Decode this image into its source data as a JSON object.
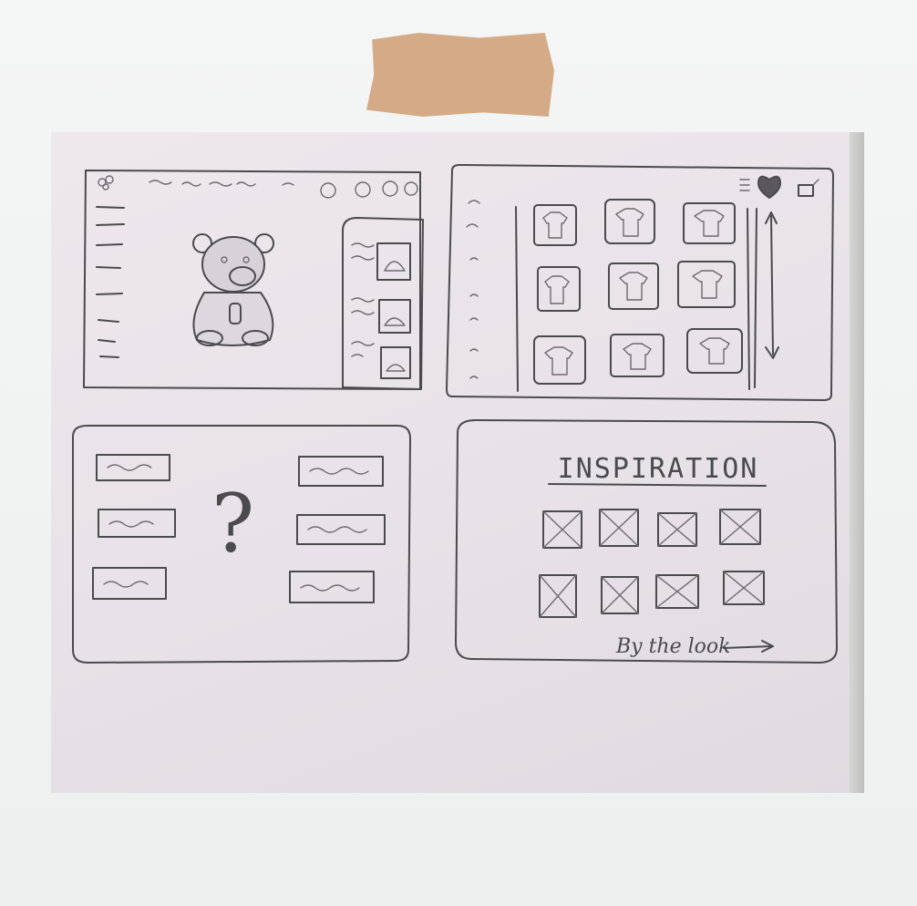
{
  "sketch": {
    "inspiration_title": "INSPIRATION",
    "by_the_look": "By the look",
    "question_mark": "?"
  },
  "colors": {
    "tape": "#d2a680",
    "paper": "#e8e4e9",
    "pencil": "#4b4a4d",
    "frame": "#f2f3f3"
  },
  "icons": [
    "heart-icon",
    "cart-icon",
    "menu-icon",
    "social-icon-g",
    "social-icon-in",
    "social-icon-f",
    "social-icon-p",
    "scroll-arrow-icon",
    "bear-drawing",
    "t-shirt-icon",
    "placeholder-x-icon"
  ]
}
